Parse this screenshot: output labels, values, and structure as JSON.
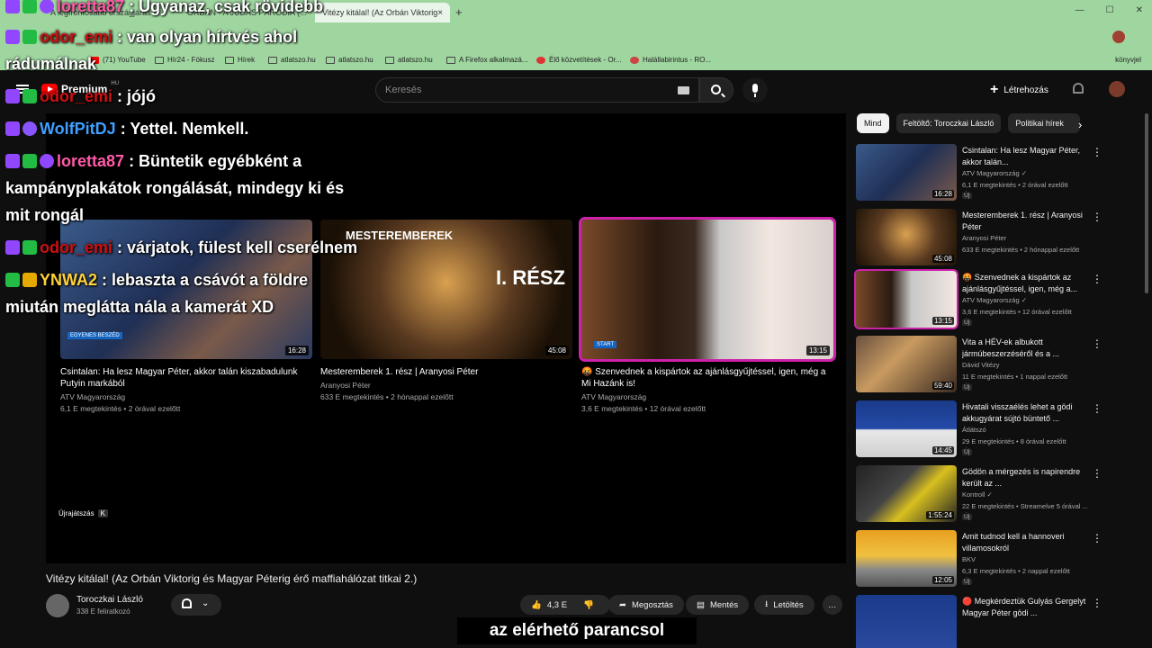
{
  "browser": {
    "tabs": [
      {
        "label": "A legfrontosabb országjárás - ..."
      },
      {
        "label": "ORBÁN - A JÚDÁS PÁRODIA (..."
      },
      {
        "label": "Vitézy kitálal! (Az Orbán Viktorig",
        "close": "×"
      }
    ],
    "new_tab": "+",
    "window_buttons": [
      "—",
      "☐",
      "✕"
    ],
    "bookmarks": [
      {
        "label": "(71) YouTube",
        "icon": "youtube-icon"
      },
      {
        "label": "Hír24 - Fókusz",
        "icon": "folder-icon"
      },
      {
        "label": "Hírek",
        "icon": "folder-icon"
      },
      {
        "label": "atlatszo.hu",
        "icon": "folder-icon"
      },
      {
        "label": "atlatszo.hu",
        "icon": "folder-icon"
      },
      {
        "label": "atlatszo.hu",
        "icon": "folder-icon"
      },
      {
        "label": "A Firefox alkalmazá...",
        "icon": "folder-icon"
      },
      {
        "label": "Élő közvetítések - Or...",
        "icon": "live-icon"
      },
      {
        "label": "Halállabirintus - RO...",
        "icon": "site-icon"
      }
    ],
    "bookmarks_right": "könyvjel"
  },
  "yt": {
    "logo_text": "Premium",
    "logo_region": "HU",
    "search_placeholder": "Keresés",
    "create_label": "Létrehozás"
  },
  "chat": [
    {
      "user": "loretta87",
      "text": ": Ugyanaz, csak rövidebb",
      "color": "#ff5aa8"
    },
    {
      "user": "odor_emi",
      "text": ": van olyan hírtvés ahol",
      "color": "#d01010"
    },
    {
      "user": "",
      "text": "rádumálnak",
      "color": "#ffffff"
    },
    {
      "user": "odor_emi",
      "text": ": jójó",
      "color": "#d01010"
    },
    {
      "user": "WolfPitDJ",
      "text": ": Yettel. Nemkell.",
      "color": "#3fa0ff"
    },
    {
      "user": "loretta87",
      "text": ": Büntetik egyébként a",
      "color": "#ff5aa8"
    },
    {
      "user": "",
      "text": "kampányplakátok rongálását, mindegy ki és",
      "color": "#ffffff"
    },
    {
      "user": "",
      "text": "mit rongál",
      "color": "#ffffff"
    },
    {
      "user": "odor_emi",
      "text": ": várjatok, fülest kell cserélnem",
      "color": "#d01010"
    },
    {
      "user": "YNWA2",
      "text": ": lebaszta a csávót a földre",
      "color": "#ffd23a"
    },
    {
      "user": "",
      "text": "miután meglátta nála a kamerát XD",
      "color": "#ffffff"
    }
  ],
  "endscreen": [
    {
      "title": "Csintalan: Ha lesz Magyar Péter, akkor talán kiszabadulunk Putyin markából",
      "channel": "ATV Magyarország",
      "meta": "6,1 E megtekintés • 2 órával ezelőtt",
      "duration": "16:28",
      "label": "EGYENES BESZÉD"
    },
    {
      "title": "Mesteremberek 1. rész | Aranyosi Péter",
      "channel": "Aranyosi Péter",
      "meta": "633 E megtekintés • 2 hónappal ezelőtt",
      "duration": "45:08",
      "label": "MESTEREMBEREK",
      "label2": "I. RÉSZ"
    },
    {
      "title": "🤬 Szenvednek a kispártok az ajánlásgyűjtéssel, igen, még a Mi Hazánk is!",
      "channel": "ATV Magyarország",
      "meta": "3,6 E megtekintés • 12 órával ezelőtt",
      "duration": "13:15",
      "label": "START"
    }
  ],
  "replay_label": "Újrajátszás",
  "replay_key": "K",
  "video": {
    "title": "Vitézy kitálal! (Az Orbán Viktorig és Magyar Péterig érő maffiahálózat titkai 2.)",
    "channel": "Toroczkai László",
    "subscribers": "338 E feliratkozó",
    "likes": "4,3 E",
    "share": "Megosztás",
    "save": "Mentés",
    "download": "Letöltés",
    "more": "…"
  },
  "caption": "az elérhető parancsol",
  "chips": [
    "Mind",
    "Feltöltő: Toroczkai László",
    "Politikai hírek"
  ],
  "chip_next": "›",
  "recommendations": [
    {
      "title": "Csintalan: Ha lesz Magyar Péter, akkor talán...",
      "channel": "ATV Magyarország ✓",
      "meta": "6,1 E megtekintés • 2 órával ezelőtt",
      "duration": "16:28",
      "new": "Új"
    },
    {
      "title": "Mesteremberek 1. rész | Aranyosi Péter",
      "channel": "Aranyosi Péter",
      "meta": "633 E megtekintés • 2 hónappal ezelőtt",
      "duration": "45:08",
      "new": ""
    },
    {
      "title": "🤬 Szenvednek a kispártok az ajánlásgyűjtéssel, igen, még a...",
      "channel": "ATV Magyarország ✓",
      "meta": "3,6 E megtekintés • 12 órával ezelőtt",
      "duration": "13:15",
      "new": "Új"
    },
    {
      "title": "Vita a HÉV-ek albukott jármúbeszerzéséről és a ...",
      "channel": "Dávid Vitézy",
      "meta": "11 E megtekintés • 1 nappal ezelőtt",
      "duration": "59:40",
      "new": "Új"
    },
    {
      "title": "Hivatali visszaélés lehet a gödi akkugyárat sújtó büntető ...",
      "channel": "Átlátszó",
      "meta": "29 E megtekintés • 8 órával ezelőtt",
      "duration": "14:45",
      "new": "Új"
    },
    {
      "title": "Gödön a mérgezés is napirendre került az ...",
      "channel": "Kontroll ✓",
      "meta": "22 E megtekintés • Streamelve 5 órával ...",
      "duration": "1:55:24",
      "new": "Új"
    },
    {
      "title": "Amit tudnod kell a hannoveri villamosokról",
      "channel": "BKV",
      "meta": "6,3 E megtekintés • 2 nappal ezelőtt",
      "duration": "12:05",
      "new": "Új"
    },
    {
      "title": "🔴 Megkérdeztük Gulyás Gergelyt Magyar Péter gödi ...",
      "channel": "",
      "meta": "",
      "duration": "",
      "new": ""
    }
  ],
  "rec_more_icon": "⋮"
}
